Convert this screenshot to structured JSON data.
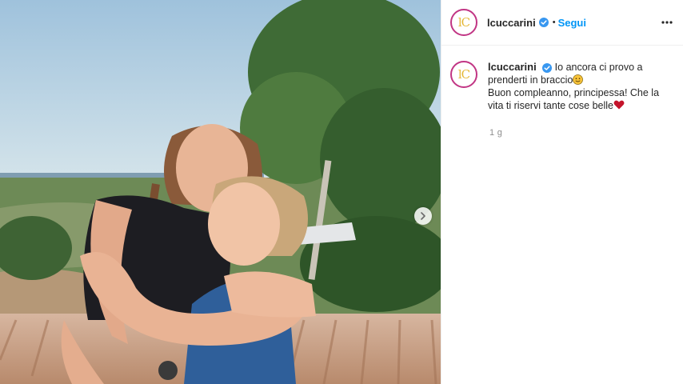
{
  "post": {
    "username": "lcuccarini",
    "avatar_initials": "lC",
    "verified_icon": "verified-badge-icon",
    "separator": "•",
    "follow_label": "Segui",
    "more_icon": "more-options-icon",
    "carousel_next_icon": "chevron-right-icon",
    "photo_description_icon": "photo",
    "caption_line_1": "Io ancora ci provo a prenderti in braccio",
    "caption_line_2": "Buon compleanno, principessa! Che la vita ti riservi tante cose belle",
    "emoji_1": "smiling-face-emoji",
    "emoji_2": "red-heart-emoji",
    "timestamp": "1 g"
  },
  "colors": {
    "accent_blue": "#0095f6",
    "avatar_ring": "#c13584",
    "avatar_letter": "#e5b93a",
    "muted_text": "#8e8e8e"
  }
}
